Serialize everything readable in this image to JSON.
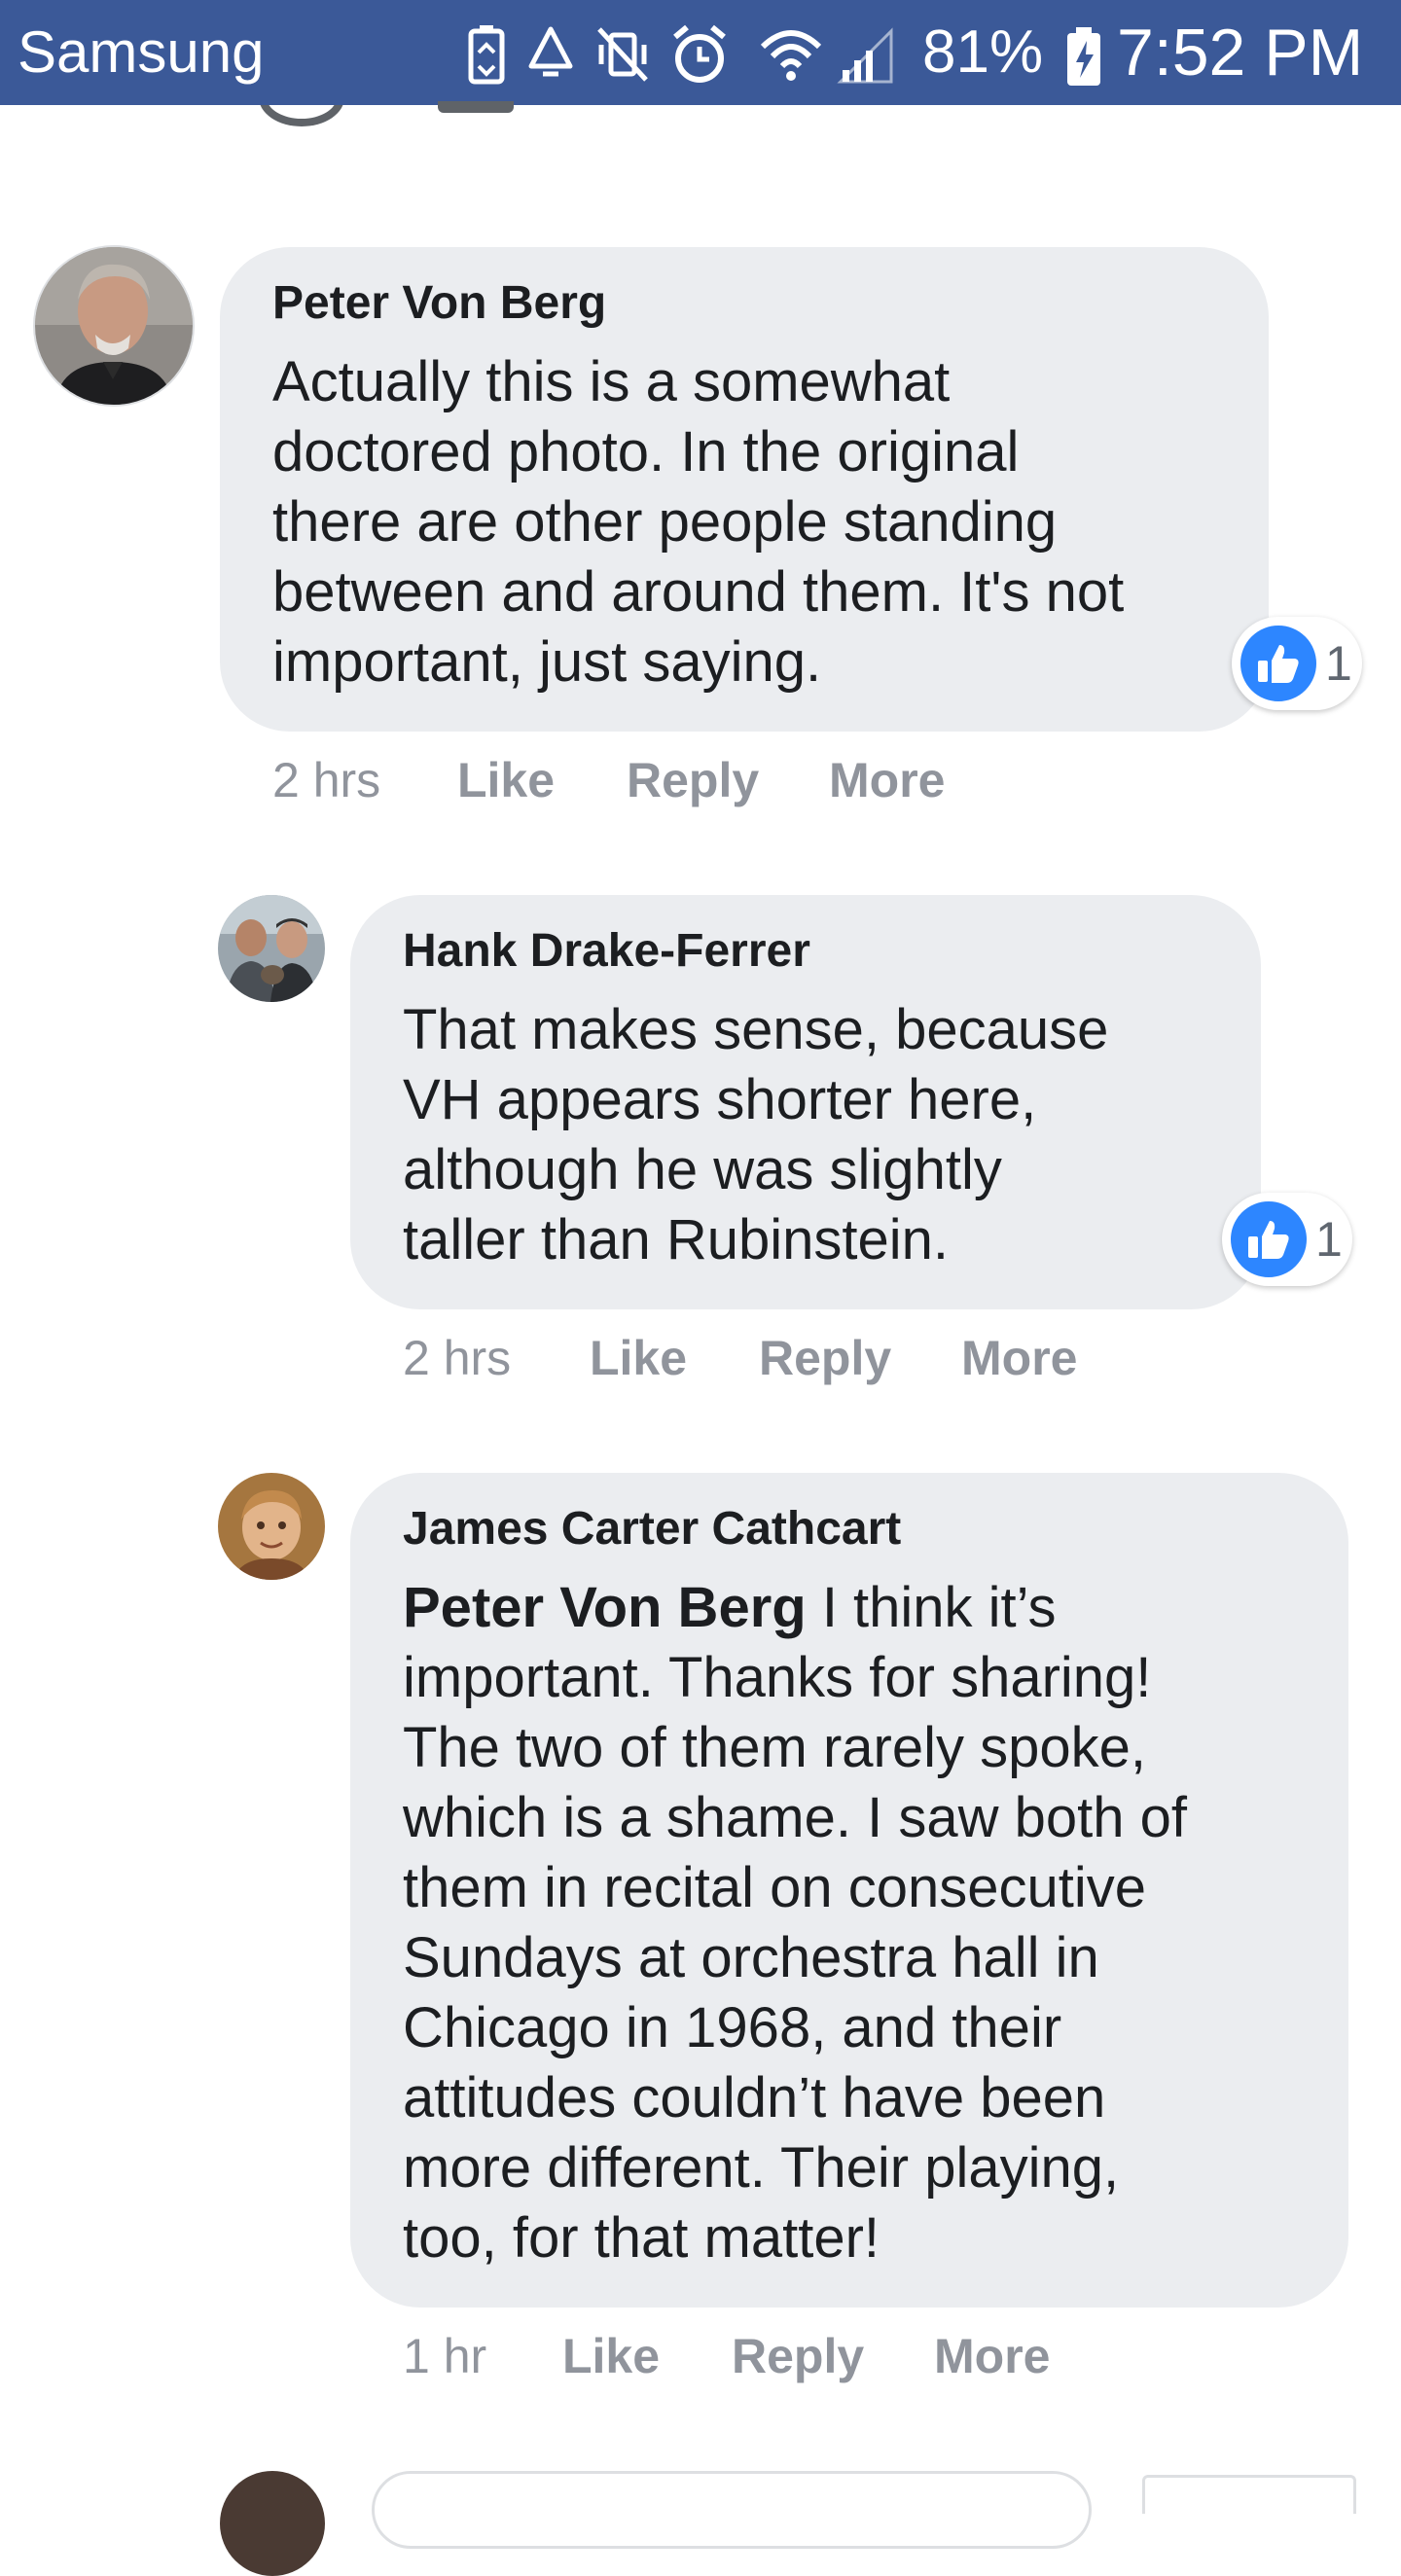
{
  "status_bar": {
    "carrier": "Samsung",
    "battery": "81%",
    "time": "7:52 PM",
    "icons": [
      "battery-saver-icon",
      "recycle-icon",
      "vibrate-icon",
      "alarm-icon",
      "wifi-icon",
      "signal-icon",
      "battery-charging-icon"
    ],
    "color": "#3b5998"
  },
  "comments": [
    {
      "author": "Peter Von Berg",
      "lines": [
        "Actually this is a somewhat",
        "doctored photo. In the original",
        "there are other people standing",
        "between and around them. It's not",
        "important, just saying."
      ],
      "reactions": "1",
      "time": "2 hrs",
      "like_label": "Like",
      "reply_label": "Reply",
      "more_label": "More"
    },
    {
      "author": "Hank Drake-Ferrer",
      "lines": [
        "That makes sense, because",
        "VH appears shorter here,",
        "although he was slightly",
        "taller than Rubinstein."
      ],
      "reactions": "1",
      "time": "2 hrs",
      "like_label": "Like",
      "reply_label": "Reply",
      "more_label": "More"
    },
    {
      "author": "James Carter Cathcart",
      "mention": "Peter Von Berg",
      "first_line_rest": " I think it’s",
      "lines": [
        "important. Thanks for sharing!",
        "The two of them rarely spoke,",
        "which is a shame. I saw both of",
        "them in recital on consecutive",
        "Sundays at orchestra hall in",
        "Chicago in 1968, and their",
        "attitudes couldn’t have been",
        "more different. Their playing,",
        "too, for that matter!"
      ],
      "time": "1 hr",
      "like_label": "Like",
      "reply_label": "Reply",
      "more_label": "More"
    }
  ],
  "colors": {
    "bubble": "#ebedf0",
    "like_blue": "#2d86ff",
    "meta_gray": "#90949c"
  }
}
